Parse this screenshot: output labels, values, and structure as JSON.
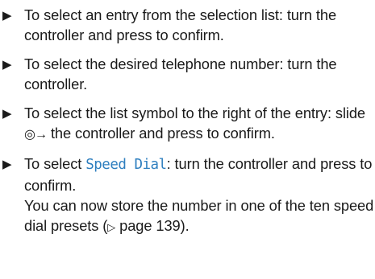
{
  "steps": [
    {
      "text": "To select an entry from the selection list: turn the controller and press to confirm."
    },
    {
      "text": "To select the desired telephone number: turn the controller."
    },
    {
      "before": "To select the list symbol to the right of the entry: slide",
      "symbol": "◎→",
      "after": "the controller and press to confirm."
    },
    {
      "before": "To select",
      "display_text": "Speed Dial",
      "after": ": turn the controller and press to confirm.",
      "note": "You can now store the number in one of the ten speed dial presets (",
      "page_ref_symbol": "▷",
      "page_ref": "page 139",
      "note_end": ")."
    }
  ],
  "icons": {
    "step_marker": "▶"
  },
  "colors": {
    "display_text": "#2f7fbf",
    "body_text": "#1a1a1a"
  }
}
